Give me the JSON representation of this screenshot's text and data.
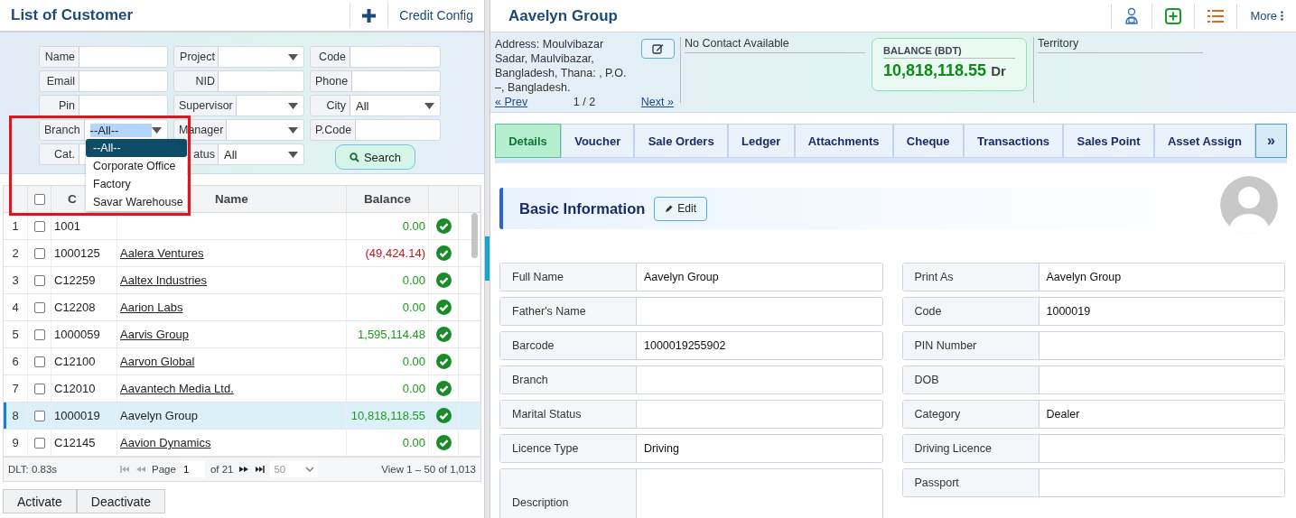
{
  "customer_list": {
    "title": "List of Customer",
    "credit_config": "Credit Config",
    "filters": [
      {
        "label": "Name",
        "kind": "text"
      },
      {
        "label": "Project",
        "kind": "select"
      },
      {
        "label": "Code",
        "kind": "text"
      },
      {
        "label": "Email",
        "kind": "text"
      },
      {
        "label": "NID",
        "kind": "text"
      },
      {
        "label": "Phone",
        "kind": "text"
      },
      {
        "label": "Pin",
        "kind": "text"
      },
      {
        "label": "Supervisor",
        "kind": "select"
      },
      {
        "label": "City",
        "kind": "select",
        "value": "All"
      },
      {
        "label": "Branch",
        "kind": "select",
        "value": "--All--",
        "open": true,
        "highlighted": true
      },
      {
        "label": "Manager",
        "kind": "select"
      },
      {
        "label": "P.Code",
        "kind": "text"
      },
      {
        "label": "Cat.",
        "kind": "text"
      },
      {
        "label": "atus",
        "kind": "select",
        "value": "All"
      }
    ],
    "search_button": "Search",
    "branch_dropdown": {
      "options": [
        {
          "label": "--All--",
          "selected": true
        },
        {
          "label": "Corporate Office",
          "selected": false
        },
        {
          "label": "Factory",
          "selected": false
        },
        {
          "label": "Savar Warehouse",
          "selected": false
        }
      ]
    },
    "table": {
      "select_all": false,
      "columns": [
        "C",
        "Name",
        "Balance"
      ],
      "rows": [
        {
          "number": "1",
          "code": "1001",
          "balance": "0.00",
          "negative": false,
          "active": true,
          "checked": false,
          "selected": false
        },
        {
          "number": "2",
          "code": "1000125",
          "name": "Aalera Ventures",
          "balance": "(49,424.14)",
          "negative": true,
          "active": true,
          "checked": false,
          "selected": false
        },
        {
          "number": "3",
          "code": "C12259",
          "name": "Aaltex Industries",
          "balance": "0.00",
          "negative": false,
          "active": true,
          "checked": false,
          "selected": false
        },
        {
          "number": "4",
          "code": "C12208",
          "name": "Aarion Labs",
          "balance": "0.00",
          "negative": false,
          "active": true,
          "checked": false,
          "selected": false
        },
        {
          "number": "5",
          "code": "1000059",
          "name": "Aarvis Group",
          "balance": "1,595,114.48",
          "negative": false,
          "active": true,
          "checked": false,
          "selected": false
        },
        {
          "number": "6",
          "code": "C12100",
          "name": "Aarvon Global",
          "balance": "0.00",
          "negative": false,
          "active": true,
          "checked": false,
          "selected": false
        },
        {
          "number": "7",
          "code": "C12010",
          "name": "Aavantech Media Ltd.",
          "balance": "0.00",
          "negative": false,
          "active": true,
          "checked": false,
          "selected": false
        },
        {
          "number": "8",
          "code": "1000019",
          "name": "Aavelyn Group",
          "balance": "10,818,118.55",
          "negative": false,
          "active": true,
          "checked": false,
          "selected": true
        },
        {
          "number": "9",
          "code": "C12145",
          "name": "Aavion Dynamics",
          "balance": "0.00",
          "negative": false,
          "active": true,
          "checked": false,
          "selected": false
        }
      ]
    },
    "footer": {
      "timing": "DLT: 0.83s",
      "page_label": "Page",
      "page": "1",
      "page_count": "of 21",
      "page_size": "50",
      "view": "View 1 – 50 of 1,013",
      "prev_disabled": true,
      "next_disabled": false
    },
    "actions": [
      "Activate",
      "Deactivate"
    ]
  },
  "customer_detail": {
    "title": "Aavelyn Group",
    "more": "More",
    "address": "Address: Moulvibazar Sadar, Maulvibazar, Bangladesh, Thana: , P.O. –, Bangladesh.",
    "prev": "« Prev",
    "pager": "1 / 2",
    "next": "Next »",
    "contact": "No Contact Available",
    "balance": {
      "label": "BALANCE (BDT)",
      "amount": "10,818,118.55",
      "side": "Dr"
    },
    "territory": "Territory",
    "tabs": [
      {
        "label": "Details",
        "selected": true
      },
      {
        "label": "Voucher",
        "selected": false
      },
      {
        "label": "Sale Orders",
        "selected": false
      },
      {
        "label": "Ledger",
        "selected": false
      },
      {
        "label": "Attachments",
        "selected": false
      },
      {
        "label": "Cheque",
        "selected": false
      },
      {
        "label": "Transactions",
        "selected": false
      },
      {
        "label": "Sales Point",
        "selected": false
      },
      {
        "label": "Asset Assign",
        "selected": false
      }
    ],
    "tabs_more": "»",
    "section": {
      "title": "Basic Information",
      "edit": "Edit"
    },
    "fields_left": [
      {
        "label": "Full Name",
        "value": "Aavelyn Group"
      },
      {
        "label": "Father's Name"
      },
      {
        "label": "Barcode",
        "value": "1000019255902"
      },
      {
        "label": "Branch"
      },
      {
        "label": "Marital Status"
      },
      {
        "label": "Licence Type",
        "value": "Driving"
      },
      {
        "label": "Description",
        "kind": "tall"
      }
    ],
    "fields_right": [
      {
        "label": "Print As",
        "value": "Aavelyn Group"
      },
      {
        "label": "Code",
        "value": "1000019"
      },
      {
        "label": "PIN Number"
      },
      {
        "label": "DOB"
      },
      {
        "label": "Category",
        "value": "Dealer"
      },
      {
        "label": "Driving Licence"
      },
      {
        "label": "Passport"
      }
    ]
  }
}
